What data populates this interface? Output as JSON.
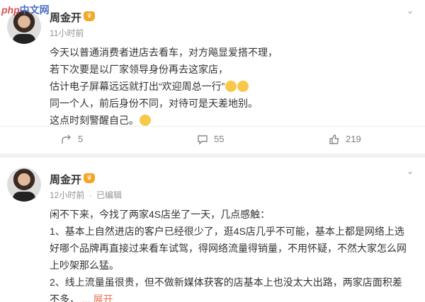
{
  "watermark": {
    "php": "php",
    "cn": "中文网"
  },
  "posts": [
    {
      "author": "周金开",
      "time": "11小时前",
      "lines": [
        "今天以普通消费者进店去看车，对方飚显爱搭不理，",
        "若下次要是以厂家领导身份再去这家店，",
        "估计电子屏幕远远就打出“欢迎周总一行”",
        "同一个人，前后身份不同，对待可是天差地别。",
        "这点时刻警醒自己。"
      ],
      "actions": {
        "share": "5",
        "comment": "55",
        "like": "219"
      },
      "icons": [
        "share-icon",
        "comment-icon",
        "like-icon"
      ]
    },
    {
      "author": "周金开",
      "time": "12小时前",
      "edited": "已编辑",
      "lines": [
        "闲不下来，今找了两家4S店坐了一天，几点感触：",
        "1、基本上自然进店的客户已经很少了，逛4S店几乎不可能，基本上都是网络上选",
        "好哪个品牌再直接过来看车试驾，得网络流量得销量，不用怀疑，不然大家怎么网",
        "上吵架那么猛。",
        "2、线上流量虽很贵，但不做新媒体获客的店基本上也没太大出路，两家店面积差",
        "不多，"
      ],
      "expand": "... 展开"
    }
  ],
  "colors": {
    "accent": "#eb7350",
    "meta": "#939393",
    "vip": "#f5a623",
    "background": "#f2f2f2"
  }
}
